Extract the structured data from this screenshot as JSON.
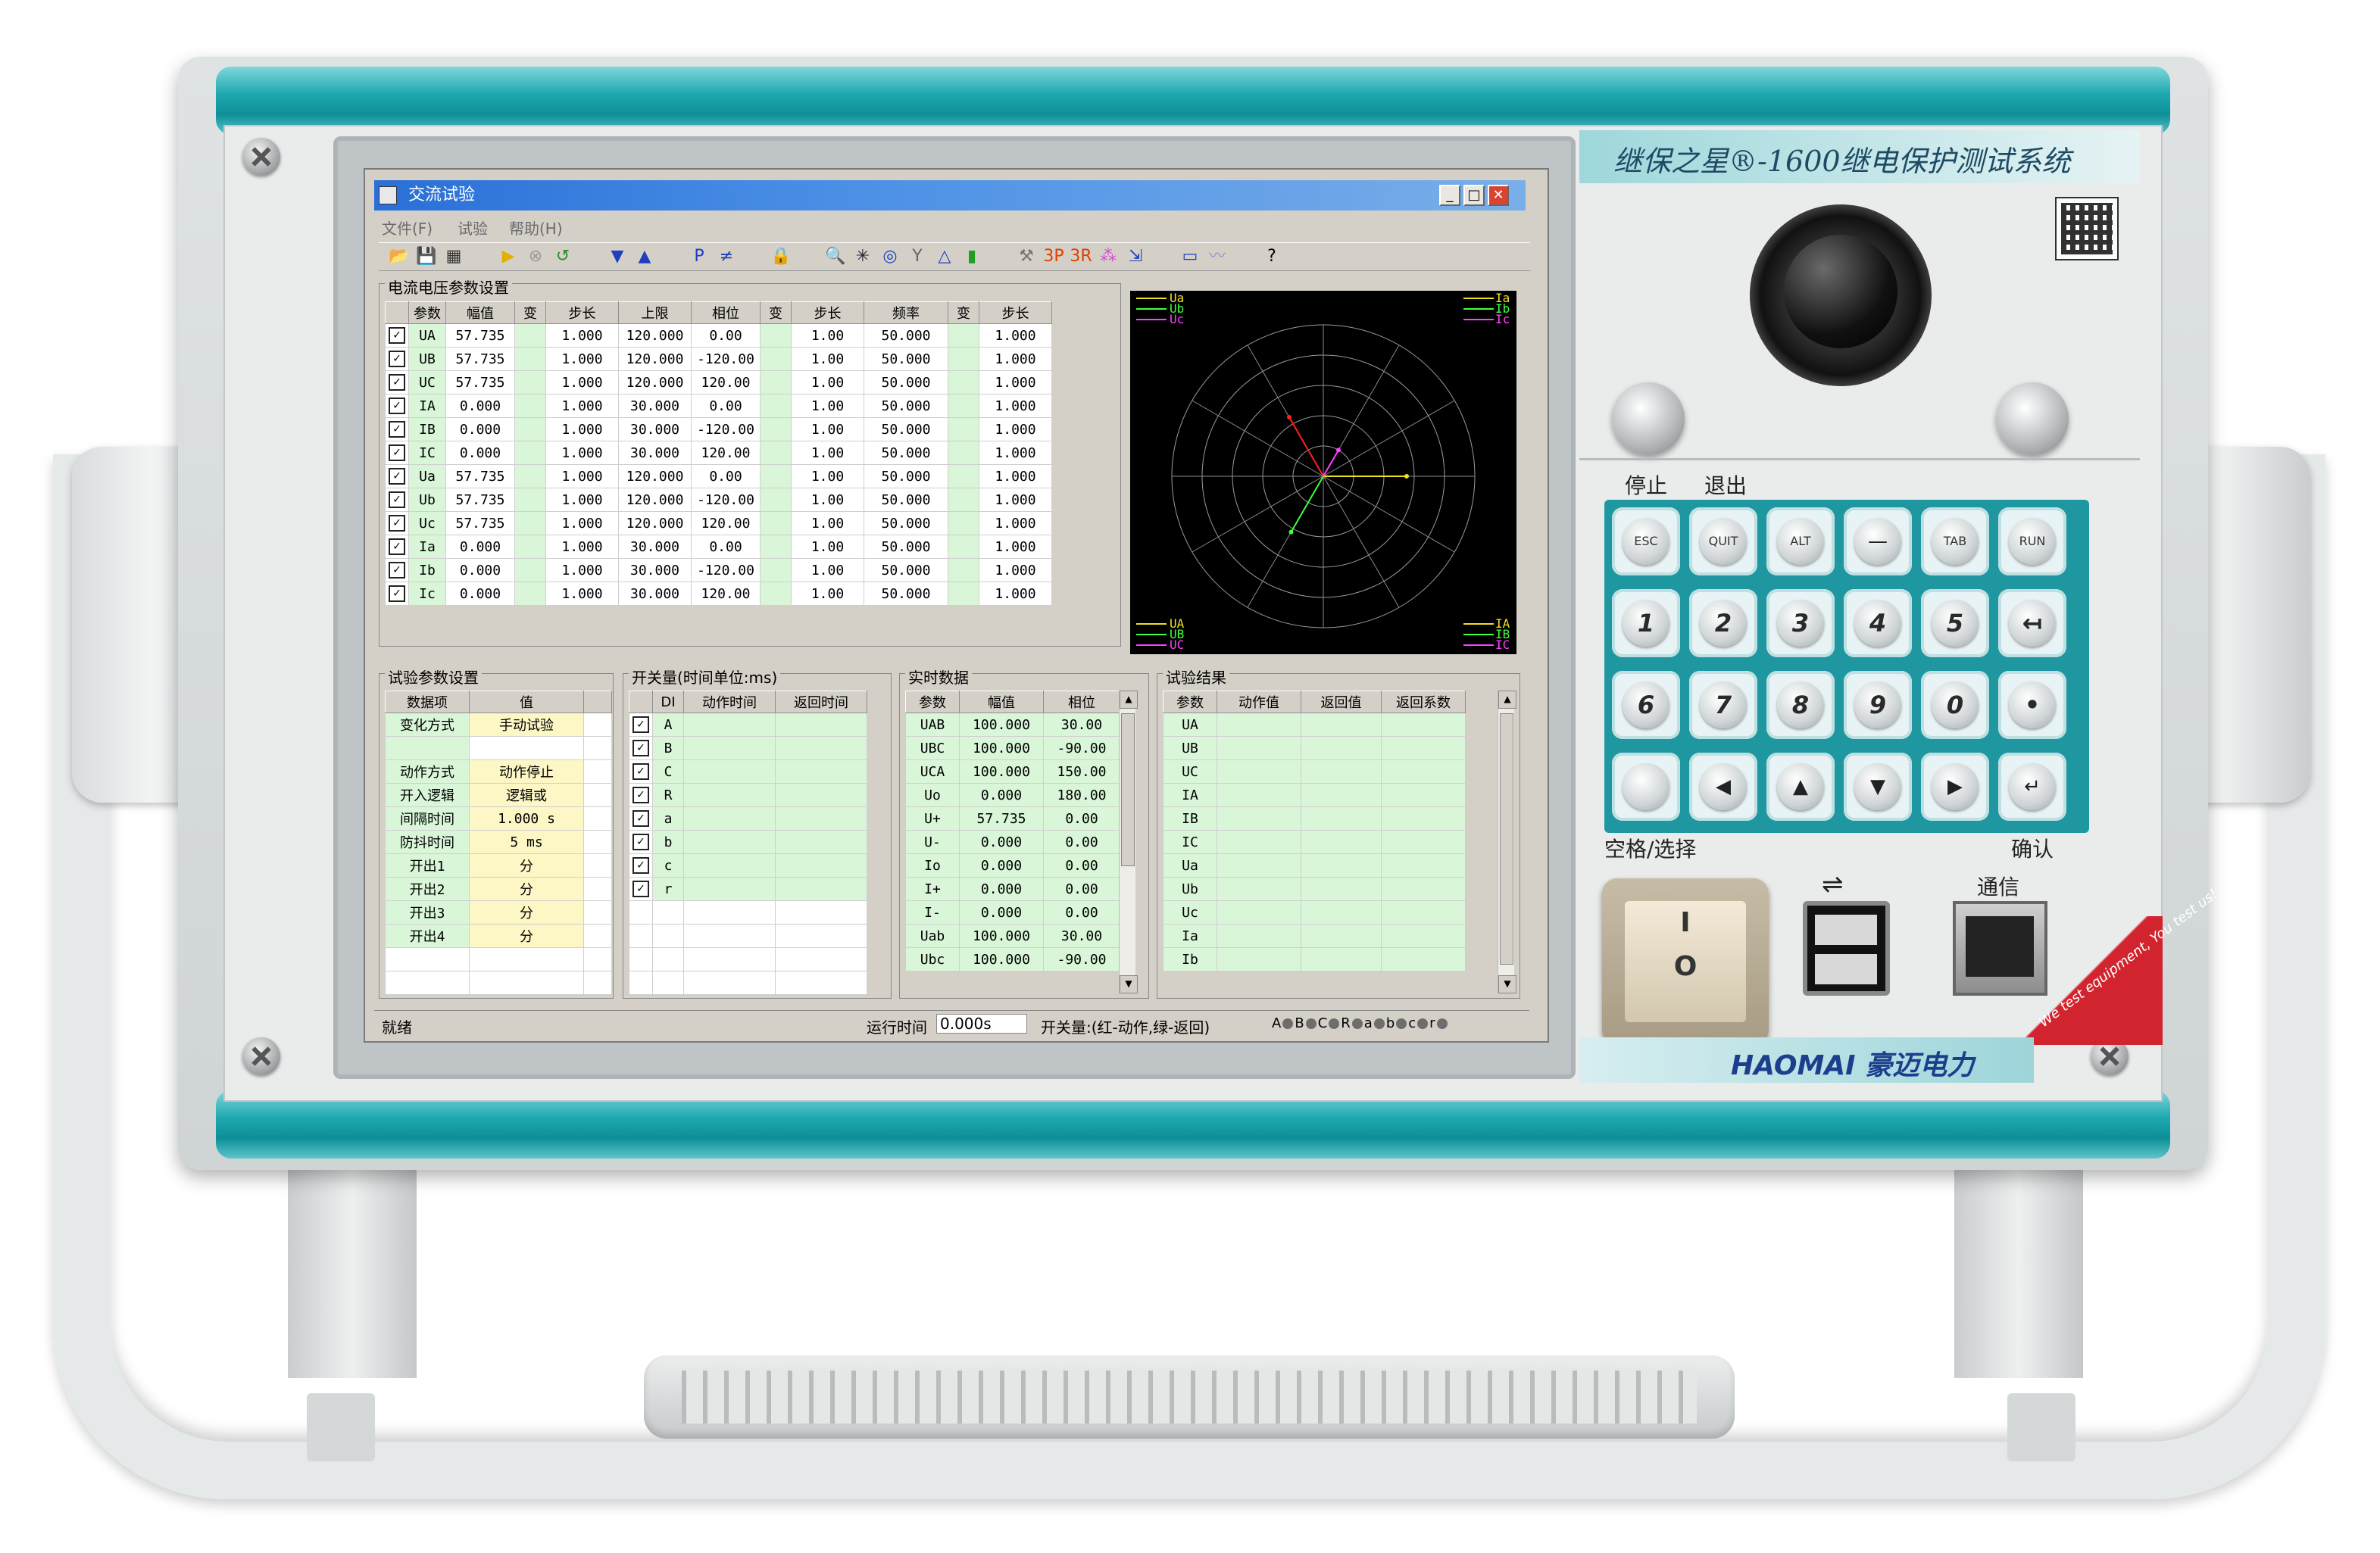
{
  "device": {
    "brand_banner": "继保之星®-1600继电保护测试系统",
    "company": "HAOMAI 豪迈电力",
    "corner_text": "We test equipment, You test us!",
    "panel_labels": {
      "stop": "停止",
      "exit": "退出",
      "space_select": "空格/选择",
      "confirm": "确认",
      "comm": "通信",
      "usb": "⇌"
    },
    "power_switch": {
      "on": "I",
      "off": "O"
    },
    "keypad": [
      [
        "ESC",
        "QUIT",
        "ALT",
        "—",
        "TAB",
        "RUN"
      ],
      [
        "1",
        "2",
        "3",
        "4",
        "5",
        "↤"
      ],
      [
        "6",
        "7",
        "8",
        "9",
        "0",
        "•"
      ],
      [
        "",
        "◀",
        "▲",
        "▼",
        "▶",
        "↵"
      ]
    ]
  },
  "app": {
    "title": "交流试验",
    "menu": [
      "文件(F)",
      "试验",
      "帮助(H)"
    ],
    "toolbar_icons": [
      "open-icon",
      "save-icon",
      "report-icon",
      "start-icon",
      "stop-icon",
      "undo-icon",
      "step-down-icon",
      "step-up-icon",
      "p-icon",
      "not-equal-icon",
      "lock-icon",
      "zoom-icon",
      "vector-icon",
      "circle-icon",
      "y-icon",
      "delta-icon",
      "bars-icon",
      "fault-icon",
      "3p-icon",
      "3r-icon",
      "color-icon",
      "export-icon",
      "monitor-icon",
      "wave-icon",
      "help-icon"
    ],
    "toolbar_glyphs": [
      "📂",
      "💾",
      "▦",
      "▶",
      "⊗",
      "↺",
      "▼",
      "▲",
      "P",
      "≠",
      "🔒",
      "🔍",
      "✳",
      "◎",
      "Y",
      "△",
      "▮",
      "⚒",
      "3P",
      "3R",
      "⁂",
      "⇲",
      "▭",
      "〰",
      "?"
    ],
    "param_group_title": "电流电压参数设置",
    "param_headers": [
      "参数",
      "幅值",
      "变",
      "步长",
      "上限",
      "相位",
      "变",
      "步长",
      "频率",
      "变",
      "步长"
    ],
    "param_rows": [
      {
        "name": "UA",
        "amp": "57.735",
        "step": "1.000",
        "upper": "120.000",
        "phase": "0.00",
        "pstep": "1.00",
        "freq": "50.000",
        "fstep": "1.000"
      },
      {
        "name": "UB",
        "amp": "57.735",
        "step": "1.000",
        "upper": "120.000",
        "phase": "-120.00",
        "pstep": "1.00",
        "freq": "50.000",
        "fstep": "1.000"
      },
      {
        "name": "UC",
        "amp": "57.735",
        "step": "1.000",
        "upper": "120.000",
        "phase": "120.00",
        "pstep": "1.00",
        "freq": "50.000",
        "fstep": "1.000"
      },
      {
        "name": "IA",
        "amp": "0.000",
        "step": "1.000",
        "upper": "30.000",
        "phase": "0.00",
        "pstep": "1.00",
        "freq": "50.000",
        "fstep": "1.000"
      },
      {
        "name": "IB",
        "amp": "0.000",
        "step": "1.000",
        "upper": "30.000",
        "phase": "-120.00",
        "pstep": "1.00",
        "freq": "50.000",
        "fstep": "1.000"
      },
      {
        "name": "IC",
        "amp": "0.000",
        "step": "1.000",
        "upper": "30.000",
        "phase": "120.00",
        "pstep": "1.00",
        "freq": "50.000",
        "fstep": "1.000"
      },
      {
        "name": "Ua",
        "amp": "57.735",
        "step": "1.000",
        "upper": "120.000",
        "phase": "0.00",
        "pstep": "1.00",
        "freq": "50.000",
        "fstep": "1.000"
      },
      {
        "name": "Ub",
        "amp": "57.735",
        "step": "1.000",
        "upper": "120.000",
        "phase": "-120.00",
        "pstep": "1.00",
        "freq": "50.000",
        "fstep": "1.000"
      },
      {
        "name": "Uc",
        "amp": "57.735",
        "step": "1.000",
        "upper": "120.000",
        "phase": "120.00",
        "pstep": "1.00",
        "freq": "50.000",
        "fstep": "1.000"
      },
      {
        "name": "Ia",
        "amp": "0.000",
        "step": "1.000",
        "upper": "30.000",
        "phase": "0.00",
        "pstep": "1.00",
        "freq": "50.000",
        "fstep": "1.000"
      },
      {
        "name": "Ib",
        "amp": "0.000",
        "step": "1.000",
        "upper": "30.000",
        "phase": "-120.00",
        "pstep": "1.00",
        "freq": "50.000",
        "fstep": "1.000"
      },
      {
        "name": "Ic",
        "amp": "0.000",
        "step": "1.000",
        "upper": "30.000",
        "phase": "120.00",
        "pstep": "1.00",
        "freq": "50.000",
        "fstep": "1.000"
      }
    ],
    "vector": {
      "legend_top_left": [
        "Ua",
        "Ub",
        "Uc"
      ],
      "legend_top_right": [
        "Ia",
        "Ib",
        "Ic"
      ],
      "legend_bottom_left": [
        "UA",
        "UB",
        "UC"
      ],
      "legend_bottom_right": [
        "IA",
        "IB",
        "IC"
      ],
      "colors": {
        "a": "#f0e020",
        "b": "#40ff40",
        "c": "#ff40ff",
        "red": "#ff2020"
      }
    },
    "test_param": {
      "title": "试验参数设置",
      "headers": [
        "数据项",
        "值"
      ],
      "rows": [
        {
          "k": "变化方式",
          "v": "手动试验"
        },
        {
          "k": "",
          "v": ""
        },
        {
          "k": "动作方式",
          "v": "动作停止"
        },
        {
          "k": "开入逻辑",
          "v": "逻辑或"
        },
        {
          "k": "间隔时间",
          "v": "1.000 s"
        },
        {
          "k": "防抖时间",
          "v": "5 ms"
        },
        {
          "k": "开出1",
          "v": "分"
        },
        {
          "k": "开出2",
          "v": "分"
        },
        {
          "k": "开出3",
          "v": "分"
        },
        {
          "k": "开出4",
          "v": "分"
        }
      ]
    },
    "switch": {
      "title": "开关量(时间单位:ms)",
      "headers": [
        "DI",
        "动作时间",
        "返回时间"
      ],
      "rows": [
        "A",
        "B",
        "C",
        "R",
        "a",
        "b",
        "c",
        "r"
      ]
    },
    "realtime": {
      "title": "实时数据",
      "headers": [
        "参数",
        "幅值",
        "相位"
      ],
      "rows": [
        {
          "p": "UAB",
          "a": "100.000",
          "ph": "30.00"
        },
        {
          "p": "UBC",
          "a": "100.000",
          "ph": "-90.00"
        },
        {
          "p": "UCA",
          "a": "100.000",
          "ph": "150.00"
        },
        {
          "p": "Uo",
          "a": "0.000",
          "ph": "180.00"
        },
        {
          "p": "U+",
          "a": "57.735",
          "ph": "0.00"
        },
        {
          "p": "U-",
          "a": "0.000",
          "ph": "0.00"
        },
        {
          "p": "Io",
          "a": "0.000",
          "ph": "0.00"
        },
        {
          "p": "I+",
          "a": "0.000",
          "ph": "0.00"
        },
        {
          "p": "I-",
          "a": "0.000",
          "ph": "0.00"
        },
        {
          "p": "Uab",
          "a": "100.000",
          "ph": "30.00"
        },
        {
          "p": "Ubc",
          "a": "100.000",
          "ph": "-90.00"
        }
      ]
    },
    "result": {
      "title": "试验结果",
      "headers": [
        "参数",
        "动作值",
        "返回值",
        "返回系数"
      ],
      "rows": [
        "UA",
        "UB",
        "UC",
        "IA",
        "IB",
        "IC",
        "Ua",
        "Ub",
        "Uc",
        "Ia",
        "Ib"
      ]
    },
    "status": {
      "ready": "就绪",
      "runtime_label": "运行时间",
      "runtime_value": "0.000s",
      "switch_label": "开关量:(红-动作,绿-返回)",
      "leds": [
        "A",
        "B",
        "C",
        "R",
        "a",
        "b",
        "c",
        "r"
      ]
    }
  }
}
